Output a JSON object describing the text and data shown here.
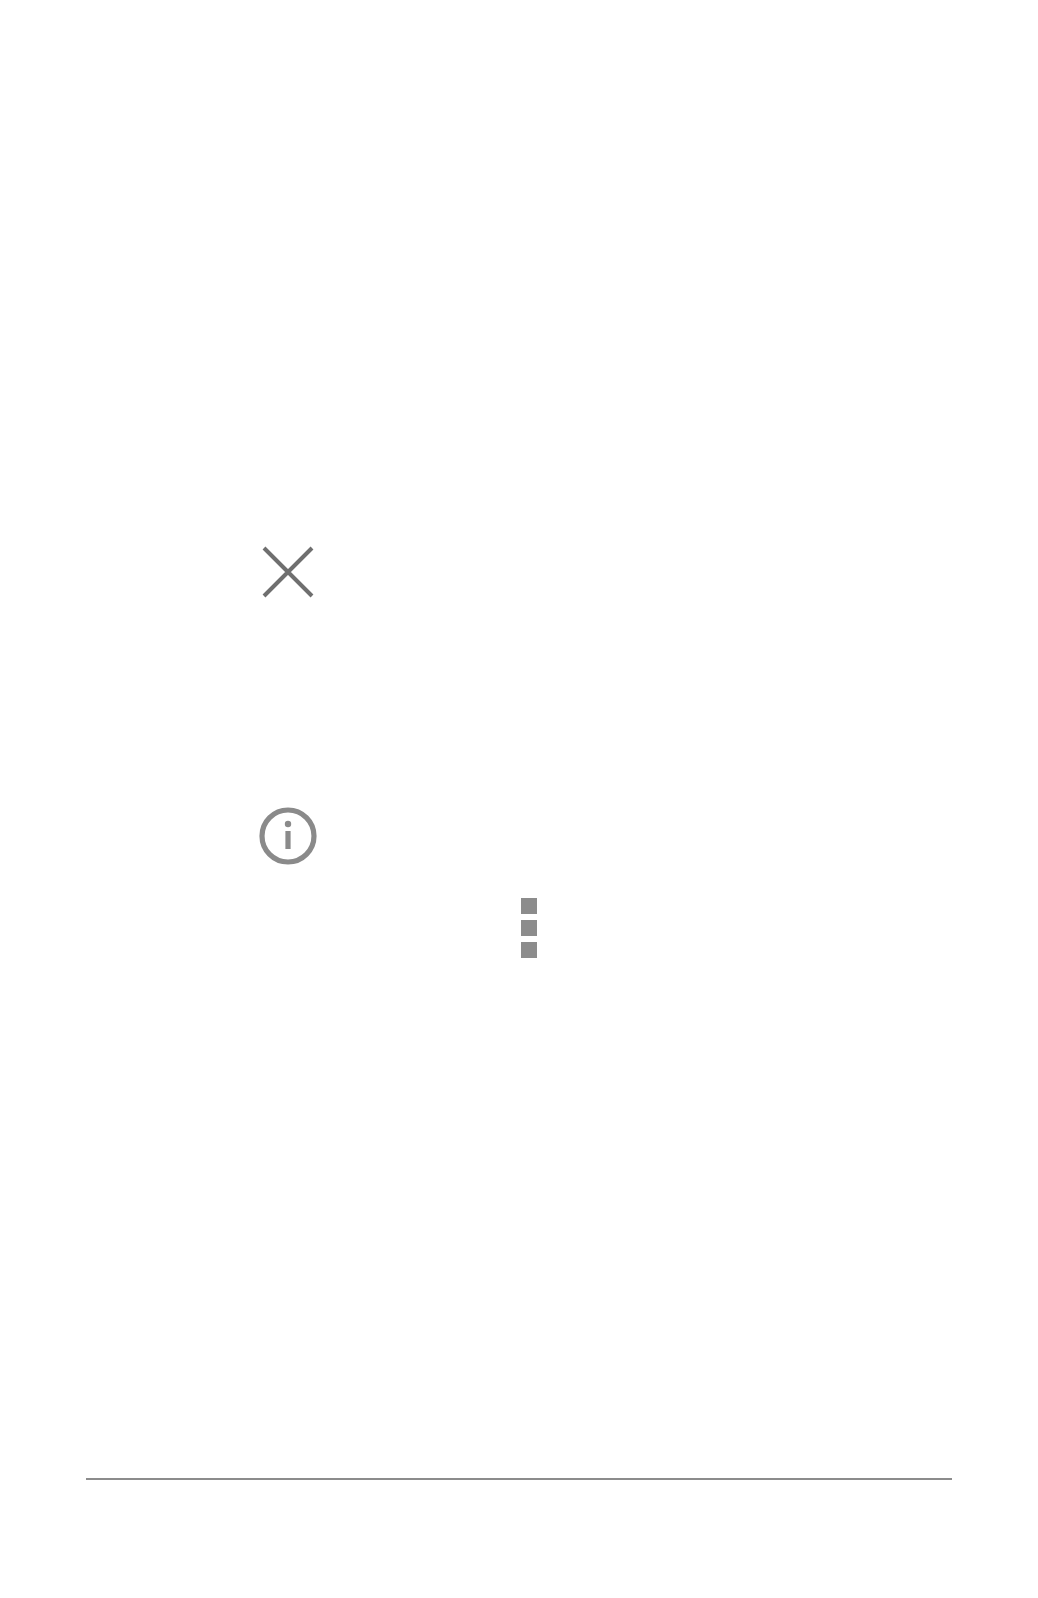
{
  "icons": [
    {
      "kind": "close"
    },
    {
      "kind": "info"
    },
    {
      "kind": "more"
    }
  ]
}
